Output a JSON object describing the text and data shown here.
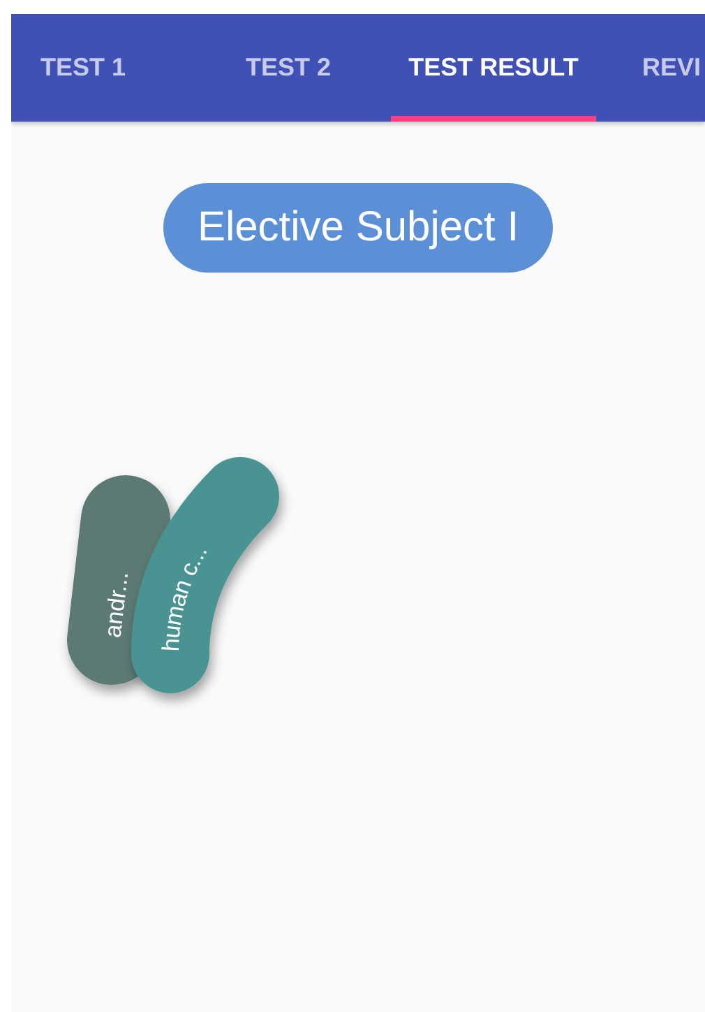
{
  "tabs": [
    {
      "label": "TEST 1",
      "selected": false
    },
    {
      "label": "TEST 2",
      "selected": false
    },
    {
      "label": "TEST RESULT",
      "selected": true
    },
    {
      "label": "REVI",
      "selected": false
    }
  ],
  "subject_title": "Elective Subject I",
  "subjects": [
    {
      "label": "andr...",
      "color": "#5b7a73"
    },
    {
      "label": "human c...",
      "color": "#4a9392"
    }
  ]
}
